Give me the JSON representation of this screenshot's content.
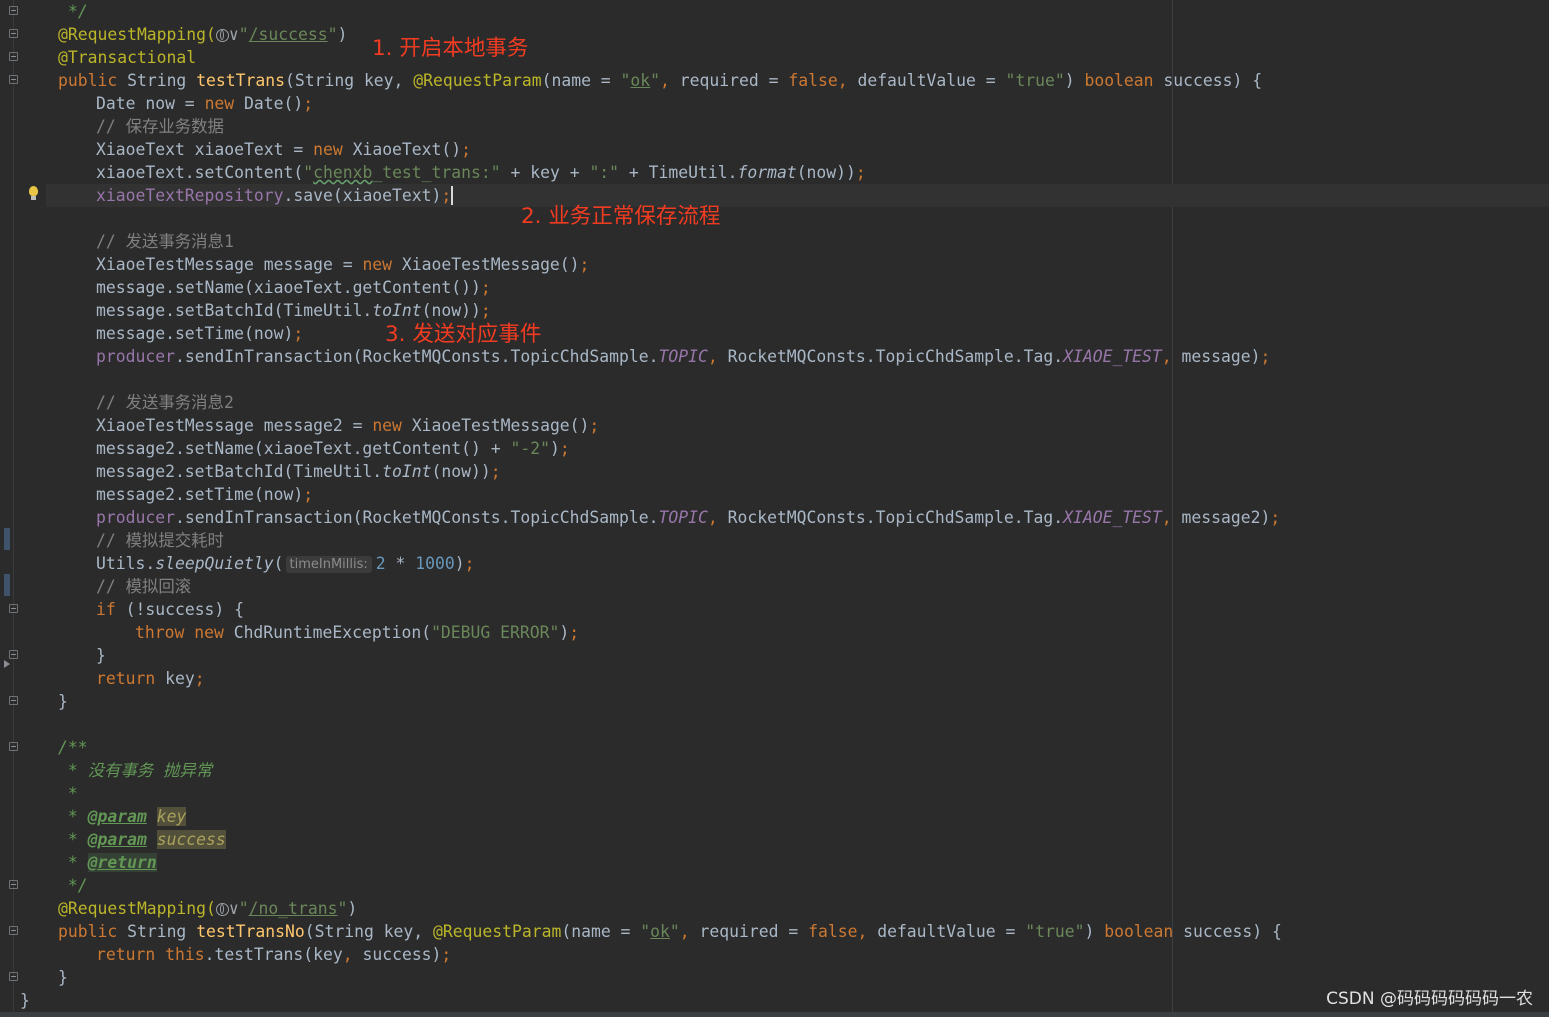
{
  "editor": {
    "language": "java",
    "theme_colors": {
      "background": "#2b2b2b",
      "keyword": "#cc7832",
      "annotation": "#bbb529",
      "string": "#6a8759",
      "number": "#6897bb",
      "comment": "#808080",
      "field": "#9876aa",
      "method_declaration": "#ffc66d",
      "annotation_note": "#f23c22"
    },
    "inlay_hint": "timeInMillis:",
    "icons": [
      "globe-icon",
      "lightbulb-icon",
      "fold-icon"
    ]
  },
  "code": {
    "l0": "*/",
    "l1_ann": "@RequestMapping(",
    "l1_drop": "∨",
    "l1_q1": "\"",
    "l1_path": "/success",
    "l1_q2": "\"",
    "l1_end": ")",
    "l2": "@Transactional",
    "l3_public": "public",
    "l3_type": "String",
    "l3_name": "testTrans",
    "l3_a": "(String key, ",
    "l3_ann": "@RequestParam",
    "l3_b": "(name = ",
    "l3_s1q": "\"",
    "l3_s1": "ok",
    "l3_s1q2": "\"",
    "l3_c1": ", ",
    "l3_c": "required = ",
    "l3_false": "false",
    "l3_c2": ", ",
    "l3_d": "defaultValue = ",
    "l3_s2": "\"true\"",
    "l3_e": ") ",
    "l3_bool": "boolean",
    "l3_f": " success) {",
    "l4_a": "Date now = ",
    "l4_new": "new",
    "l4_b": " Date()",
    "l4_semi": ";",
    "l5": "// 保存业务数据",
    "l6_a": "XiaoeText xiaoeText = ",
    "l6_new": "new",
    "l6_b": " XiaoeText()",
    "l6_semi": ";",
    "l7_a": "xiaoeText.setContent(",
    "l7_q": "\"",
    "l7_typo": "chenxb",
    "l7_s": "_test_trans:\"",
    "l7_b": " + key + ",
    "l7_s2": "\":\"",
    "l7_c": " + TimeUtil.",
    "l7_fmt": "format",
    "l7_d": "(now))",
    "l7_semi": ";",
    "l8_field": "xiaoeTextRepository",
    "l8_a": ".save(xiaoeText)",
    "l8_semi": ";",
    "l10": "// 发送事务消息1",
    "l11_a": "XiaoeTestMessage message = ",
    "l11_new": "new",
    "l11_b": " XiaoeTestMessage()",
    "l11_semi": ";",
    "l12_a": "message.setName(xiaoeText.getContent())",
    "l12_semi": ";",
    "l13_a": "message.setBatchId(TimeUtil.",
    "l13_toint": "toInt",
    "l13_b": "(now))",
    "l13_semi": ";",
    "l14_a": "message.setTime(now)",
    "l14_semi": ";",
    "l15_field": "producer",
    "l15_a": ".sendInTransaction(RocketMQConsts.TopicChdSample.",
    "l15_topic": "TOPIC",
    "l15_c1": ", ",
    "l15_b": "RocketMQConsts.TopicChdSample.Tag.",
    "l15_tag": "XIAOE_TEST",
    "l15_c2": ", ",
    "l15_c": "message)",
    "l15_semi": ";",
    "l17": "// 发送事务消息2",
    "l18_a": "XiaoeTestMessage message2 = ",
    "l18_new": "new",
    "l18_b": " XiaoeTestMessage()",
    "l18_semi": ";",
    "l19_a": "message2.setName(xiaoeText.getContent() + ",
    "l19_s": "\"-2\"",
    "l19_b": ")",
    "l19_semi": ";",
    "l20_a": "message2.setBatchId(TimeUtil.",
    "l20_toint": "toInt",
    "l20_b": "(now))",
    "l20_semi": ";",
    "l21_a": "message2.setTime(now)",
    "l21_semi": ";",
    "l22_field": "producer",
    "l22_a": ".sendInTransaction(RocketMQConsts.TopicChdSample.",
    "l22_topic": "TOPIC",
    "l22_c1": ", ",
    "l22_b": "RocketMQConsts.TopicChdSample.Tag.",
    "l22_tag": "XIAOE_TEST",
    "l22_c2": ", ",
    "l22_c": "message2)",
    "l22_semi": ";",
    "l23": "// 模拟提交耗时",
    "l24_a": "Utils.",
    "l24_sleep": "sleepQuietly",
    "l24_b": "(",
    "l24_n1": "2",
    "l24_c": " * ",
    "l24_n2": "1000",
    "l24_d": ")",
    "l24_semi": ";",
    "l25": "// 模拟回滚",
    "l26_if": "if",
    "l26_a": " (!success) {",
    "l27_throw": "throw",
    "l27_new": "new",
    "l27_a": " ChdRuntimeException(",
    "l27_s": "\"DEBUG ERROR\"",
    "l27_b": ")",
    "l27_semi": ";",
    "l28": "}",
    "l29_return": "return",
    "l29_a": " key",
    "l29_semi": ";",
    "l30": "}",
    "l32": "/**",
    "l33": " * 没有事务 抛异常",
    "l34": " *",
    "l35_star": " * ",
    "l35_tag": "@param",
    "l35_sp": " ",
    "l35_name": "key",
    "l36_star": " * ",
    "l36_tag": "@param",
    "l36_sp": " ",
    "l36_name": "success",
    "l37_star": " * ",
    "l37_tag": "@return",
    "l38": " */",
    "l39_ann": "@RequestMapping(",
    "l39_drop": "∨",
    "l39_q1": "\"",
    "l39_path": "/no_trans",
    "l39_q2": "\"",
    "l39_end": ")",
    "l40_public": "public",
    "l40_type": "String",
    "l40_name": "testTransNo",
    "l40_a": "(String key, ",
    "l40_ann": "@RequestParam",
    "l40_b": "(name = ",
    "l40_s1q": "\"",
    "l40_s1": "ok",
    "l40_s1q2": "\"",
    "l40_c1": ", ",
    "l40_c": "required = ",
    "l40_false": "false",
    "l40_c2": ", ",
    "l40_d": "defaultValue = ",
    "l40_s2": "\"true\"",
    "l40_e": ") ",
    "l40_bool": "boolean",
    "l40_f": " success) {",
    "l41_return": "return",
    "l41_this": "this",
    "l41_a": ".testTrans(key",
    "l41_comma": ",",
    "l41_b": " success)",
    "l41_semi": ";",
    "l42": "}",
    "l43": "}"
  },
  "annotations": {
    "note1": "1. 开启本地事务",
    "note2": "2. 业务正常保存流程",
    "note3": "3. 发送对应事件"
  },
  "watermark": "CSDN @码码码码码码一农"
}
